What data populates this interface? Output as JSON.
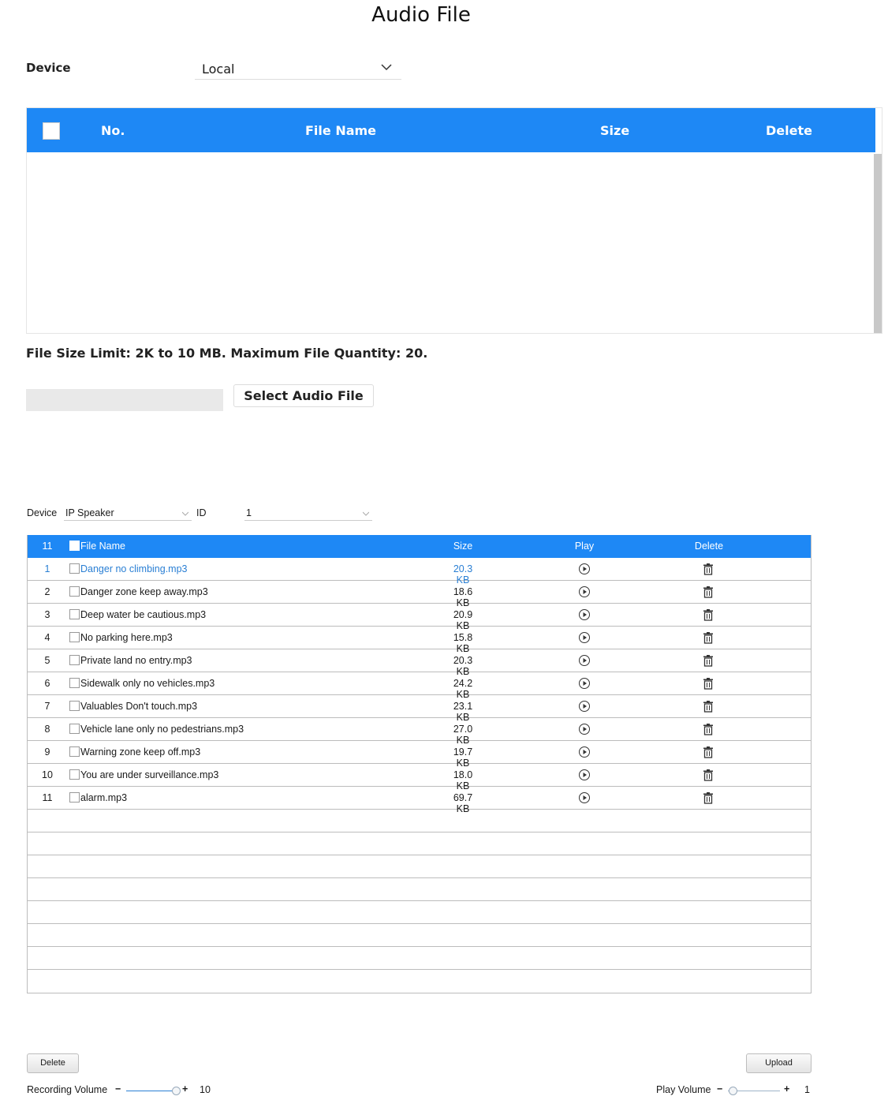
{
  "title": "Audio File",
  "upper": {
    "device_label": "Device",
    "device_value": "Local",
    "columns": [
      "No.",
      "File Name",
      "Size",
      "Delete"
    ],
    "limit_text": "File Size Limit: 2K to 10 MB. Maximum File Quantity: 20.",
    "select_button": "Select Audio File"
  },
  "lower": {
    "device_label": "Device",
    "device_value": "IP Speaker",
    "id_label": "ID",
    "id_value": "1",
    "header": {
      "count": "11",
      "file_name": "File Name",
      "size": "Size",
      "play": "Play",
      "delete": "Delete"
    },
    "rows": [
      {
        "no": "1",
        "name": "Danger no climbing.mp3",
        "size": "20.3 KB"
      },
      {
        "no": "2",
        "name": "Danger zone keep away.mp3",
        "size": "18.6 KB"
      },
      {
        "no": "3",
        "name": "Deep water be cautious.mp3",
        "size": "20.9 KB"
      },
      {
        "no": "4",
        "name": "No parking here.mp3",
        "size": "15.8 KB"
      },
      {
        "no": "5",
        "name": "Private land no entry.mp3",
        "size": "20.3 KB"
      },
      {
        "no": "6",
        "name": "Sidewalk only no vehicles.mp3",
        "size": "24.2 KB"
      },
      {
        "no": "7",
        "name": "Valuables Don't touch.mp3",
        "size": "23.1 KB"
      },
      {
        "no": "8",
        "name": "Vehicle lane only no pedestrians.mp3",
        "size": "27.0 KB"
      },
      {
        "no": "9",
        "name": "Warning zone keep off.mp3",
        "size": "19.7 KB"
      },
      {
        "no": "10",
        "name": "You are under surveillance.mp3",
        "size": "18.0 KB"
      },
      {
        "no": "11",
        "name": "alarm.mp3",
        "size": "69.7 KB"
      }
    ],
    "delete_button": "Delete",
    "upload_button": "Upload",
    "recording_volume": {
      "label": "Recording Volume",
      "value": "10",
      "minus": "−",
      "plus": "+",
      "level": 1.0
    },
    "play_volume": {
      "label": "Play Volume",
      "value": "1",
      "minus": "−",
      "plus": "+",
      "level": 0.1
    }
  },
  "colors": {
    "accent": "#1e88f5",
    "link": "#2a7fd4"
  }
}
